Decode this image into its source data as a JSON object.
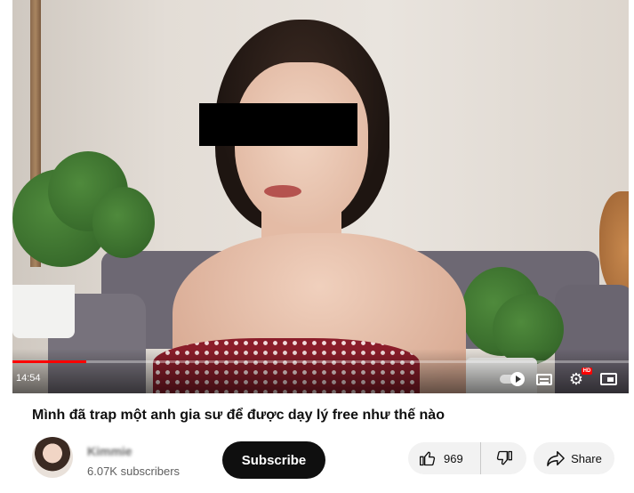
{
  "video": {
    "time": "14:54",
    "progress": 0.12,
    "progress_color": "#ff0000",
    "hd_badge": "HD"
  },
  "title": "Mình đã trap một anh gia sư để được dạy lý free như thế nào",
  "channel": {
    "name": "Kimmie",
    "subscribers": "6.07K subscribers"
  },
  "actions": {
    "subscribe_label": "Subscribe",
    "like_count": "969",
    "share_label": "Share"
  },
  "icons": [
    "autoplay-toggle-icon",
    "captions-icon",
    "settings-gear-icon",
    "miniplayer-icon",
    "thumbs-up-icon",
    "thumbs-down-icon",
    "share-arrow-icon"
  ]
}
